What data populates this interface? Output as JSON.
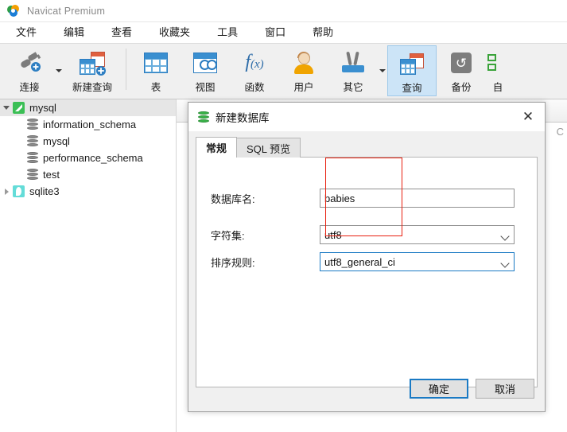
{
  "window": {
    "title": "Navicat Premium",
    "logo_icon": "navicat-logo-icon"
  },
  "menubar": {
    "items": [
      {
        "label": "文件"
      },
      {
        "label": "编辑"
      },
      {
        "label": "查看"
      },
      {
        "label": "收藏夹"
      },
      {
        "label": "工具"
      },
      {
        "label": "窗口"
      },
      {
        "label": "帮助"
      }
    ]
  },
  "toolbar": {
    "items": [
      {
        "label": "连接",
        "icon": "connection-icon",
        "has_dropdown": true,
        "selected": false
      },
      {
        "label": "新建查询",
        "icon": "new-query-icon",
        "has_dropdown": false,
        "selected": false
      },
      {
        "label": "表",
        "icon": "table-icon",
        "has_dropdown": false,
        "selected": false
      },
      {
        "label": "视图",
        "icon": "view-icon",
        "has_dropdown": false,
        "selected": false
      },
      {
        "label": "函数",
        "icon": "function-fx-icon",
        "has_dropdown": false,
        "selected": false
      },
      {
        "label": "用户",
        "icon": "user-icon",
        "has_dropdown": false,
        "selected": false
      },
      {
        "label": "其它",
        "icon": "other-tools-icon",
        "has_dropdown": true,
        "selected": false
      },
      {
        "label": "查询",
        "icon": "query-icon",
        "has_dropdown": false,
        "selected": true
      },
      {
        "label": "备份",
        "icon": "backup-icon",
        "has_dropdown": false,
        "selected": false
      },
      {
        "label": "自",
        "icon": "automation-icon",
        "has_dropdown": false,
        "selected": false
      }
    ]
  },
  "sidebar": {
    "tree": [
      {
        "label": "mysql",
        "level": 0,
        "icon": "mysql-connection-icon",
        "expander": "expanded",
        "selected": true
      },
      {
        "label": "information_schema",
        "level": 1,
        "icon": "database-icon",
        "expander": "none",
        "selected": false
      },
      {
        "label": "mysql",
        "level": 1,
        "icon": "database-icon",
        "expander": "none",
        "selected": false
      },
      {
        "label": "performance_schema",
        "level": 1,
        "icon": "database-icon",
        "expander": "none",
        "selected": false
      },
      {
        "label": "test",
        "level": 1,
        "icon": "database-icon",
        "expander": "none",
        "selected": false
      },
      {
        "label": "sqlite3",
        "level": 0,
        "icon": "sqlite-connection-icon",
        "expander": "collapsed",
        "selected": false
      }
    ]
  },
  "main": {
    "ghost_text": "C"
  },
  "dialog": {
    "title": "新建数据库",
    "title_icon": "database-icon",
    "close_icon": "close-icon",
    "tabs": [
      {
        "label": "常规",
        "active": true
      },
      {
        "label": "SQL 预览",
        "active": false
      }
    ],
    "form": [
      {
        "label": "数据库名:",
        "value": "babies",
        "type": "text",
        "focused": false,
        "name": "database-name-field"
      },
      {
        "label": "字符集:",
        "value": "utf8",
        "type": "select",
        "focused": false,
        "name": "charset-select"
      },
      {
        "label": "排序规则:",
        "value": "utf8_general_ci",
        "type": "select",
        "focused": true,
        "name": "collation-select"
      }
    ],
    "buttons": {
      "ok": "确定",
      "cancel": "取消"
    }
  },
  "annotation": {
    "color": "#e8200f",
    "shape": "rectangle"
  }
}
